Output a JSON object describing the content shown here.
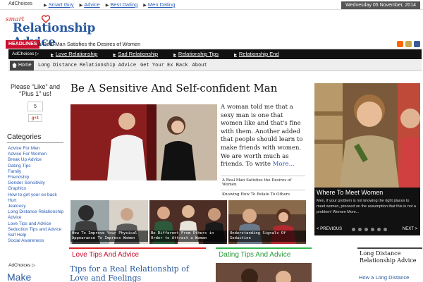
{
  "top_bar": {
    "adchoices": "AdChoices",
    "links": [
      "Smart Guy",
      "Advice",
      "Best Dating",
      "Men Dating"
    ],
    "date": "Wednesday 05 November, 2014"
  },
  "logo": {
    "smart": "smart",
    "title": "Relationship Advice"
  },
  "headlines": {
    "label": "HEADLINES",
    "text": "A Real Man Satisfies the Desires of Women"
  },
  "nav_primary": {
    "adchoices": "AdChoices",
    "items": [
      "Love Relationship",
      "Sad Relationship",
      "Relationship Tips",
      "Relationship End"
    ]
  },
  "nav_secondary": {
    "home": "Home",
    "items": [
      "Long Distance Relationship Advice",
      "Get Your Ex Back",
      "About"
    ]
  },
  "like_box": {
    "text": "Please “Like” and “Plus 1” us!",
    "count": "5",
    "gplus": "g+1"
  },
  "categories": {
    "heading": "Categories",
    "items": [
      "Advice For Men",
      "Advice For Women",
      "Break Up Advice",
      "Dating Tips",
      "Family",
      "Friendship",
      "Gender Sensitivity",
      "Graphics",
      "How to get your ex back",
      "Hurt",
      "Jealousy",
      "Long Distance Relationship Advice",
      "Love Tips and Advice",
      "Seduction Tips and Advice",
      "Self Help",
      "Social Awareness"
    ]
  },
  "sidebar_bottom": {
    "adchoices": "AdChoices",
    "make": "Make"
  },
  "article": {
    "title": "Be A Sensitive And Self-confident Man",
    "text": "A woman told me that a sexy man is one that women like and that's fine with them. Another added that people should learn to make friends with women. We are worth much as friends. To write ",
    "more": "More...",
    "related": [
      "A Real Man Satisfies the Desires of Women",
      "Knowing How To Relate To Others"
    ]
  },
  "thumbnails": [
    "How To Improve Your Physical Appearance To Impress Women",
    "Be Different From Others in Order to Attract a Woman",
    "Understanding Signals Of Seduction"
  ],
  "slider": {
    "title": "Where To Meet Women",
    "description": "Men, if your problem is not knowing the right places to meet women, proceed on the assumption that this is not a problem! Women More...",
    "prev": "< PREVIOUS",
    "next": "NEXT >"
  },
  "sections": {
    "love": {
      "heading": "Love Tips And Advice",
      "post_title": "Tips for a Real Relationship of Love and Feelings"
    },
    "dating": {
      "heading": "Dating Tips And Advice"
    },
    "long_distance": {
      "heading": "Long Distance Relationship Advice",
      "link": "How a Long Distance"
    }
  },
  "colors": {
    "brand_blue": "#2a5aa0",
    "headline_red": "#c8102e",
    "dating_green": "#2db84d",
    "nav_black": "#111111"
  }
}
